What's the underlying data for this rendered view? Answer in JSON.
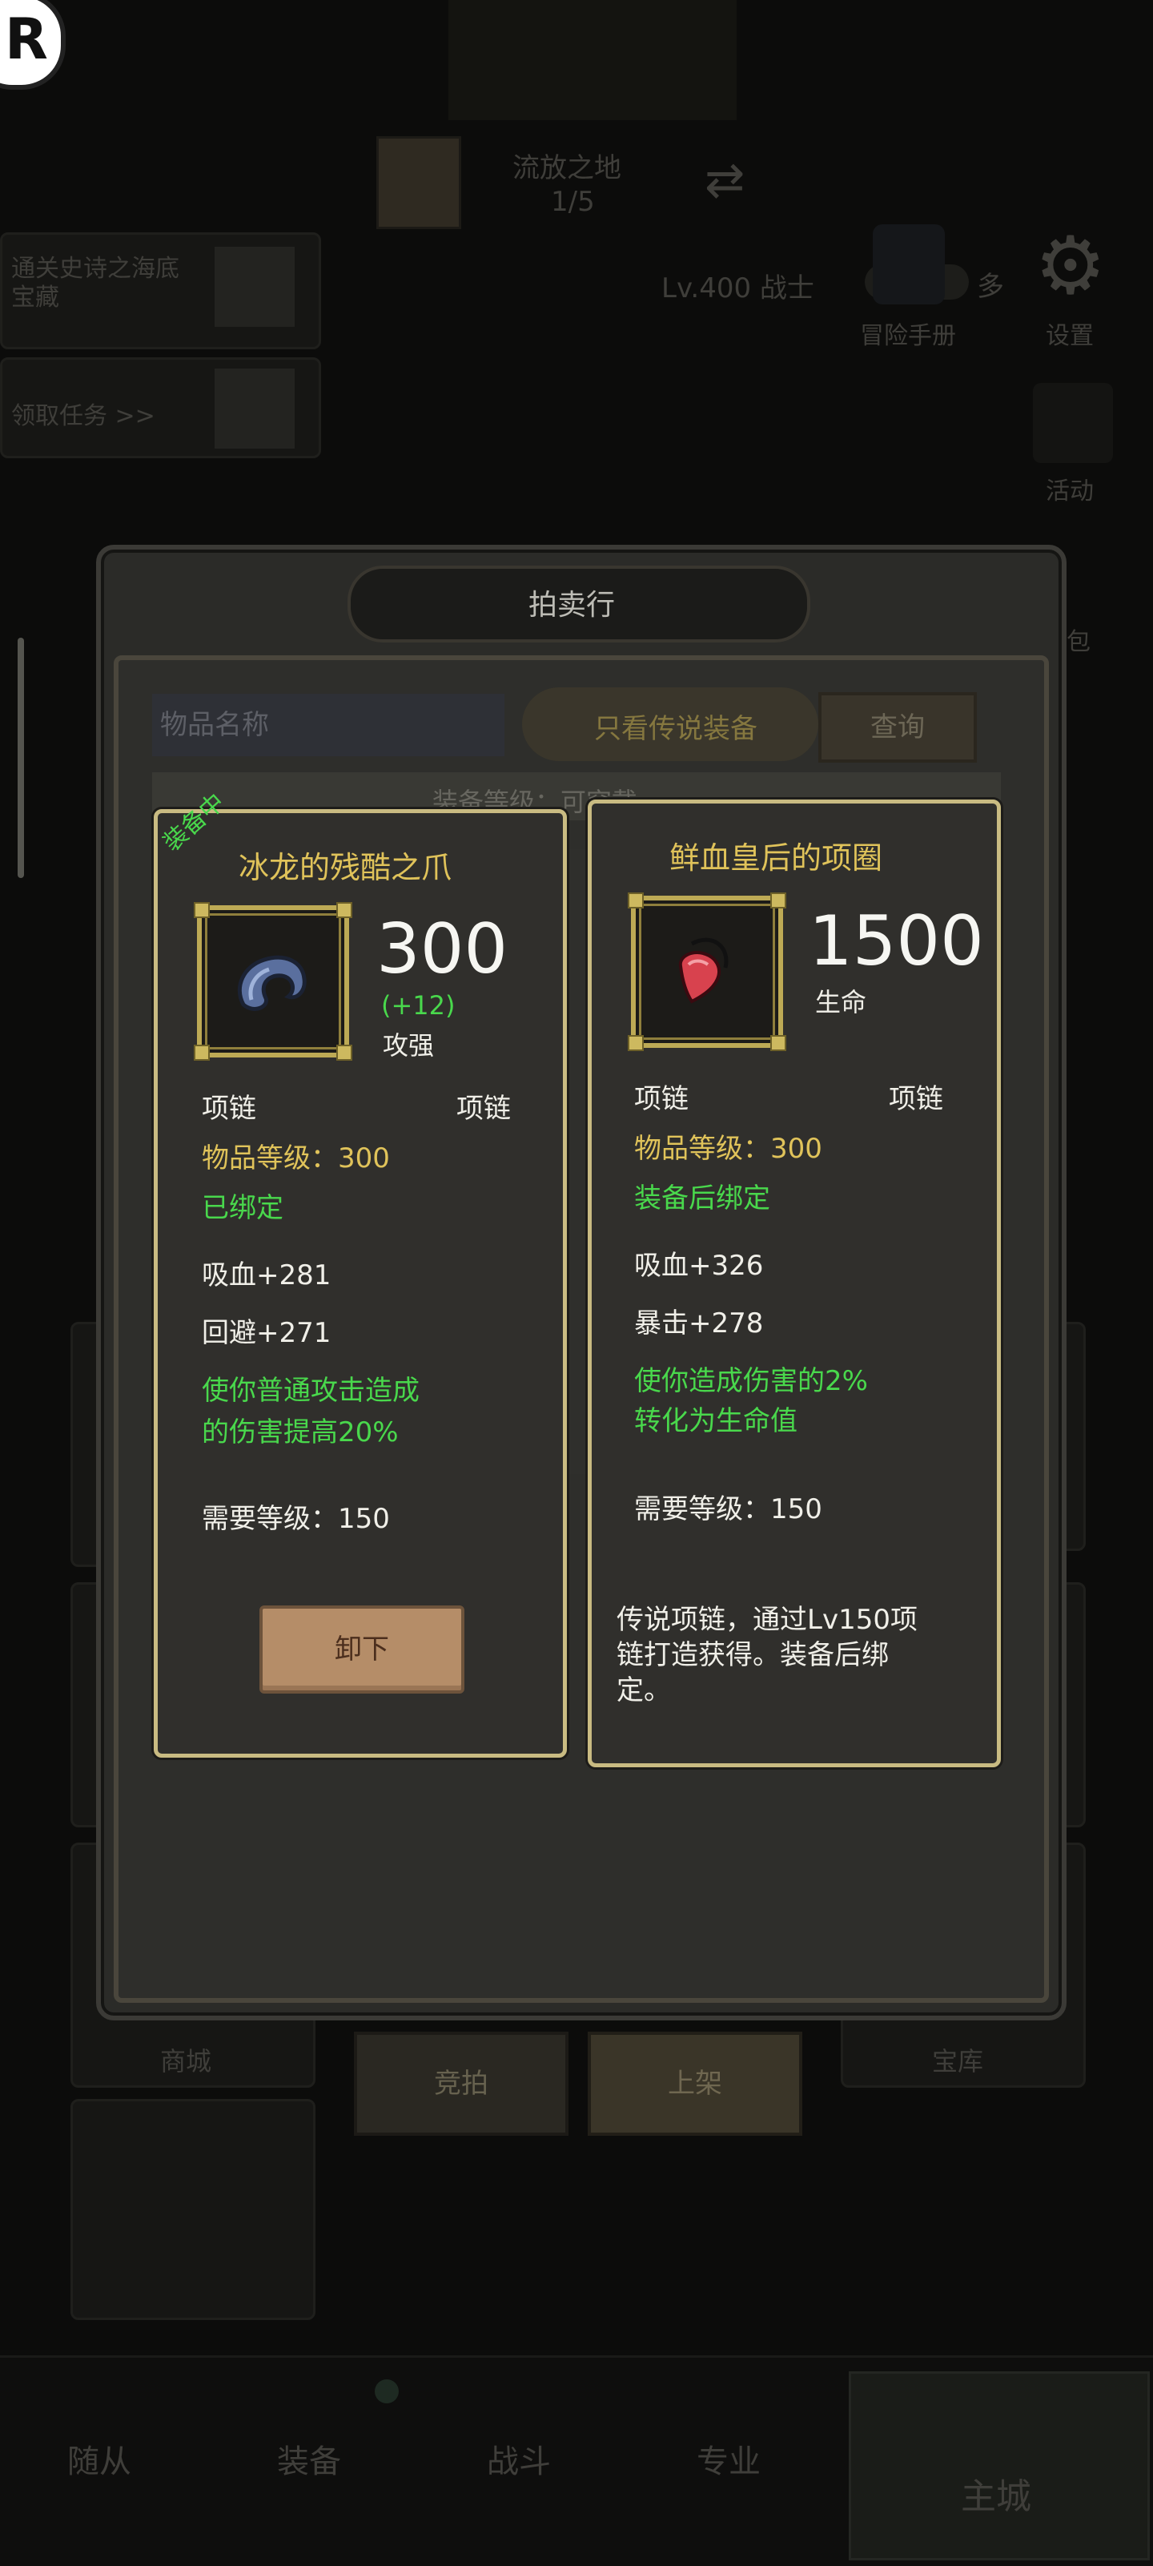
{
  "background": {
    "map_name": "流放之地",
    "map_progress": "1/5",
    "quest1": "通关史诗之海底宝藏",
    "quest2": "领取任务 >>",
    "player": "Lv.400 战士",
    "multi_label": "多",
    "adventure_manual": "冒险手册",
    "settings": "设置",
    "activity": "活动",
    "gift_bag": "包",
    "shop": "商城",
    "treasury": "宝库",
    "bottom_tabs": [
      "随从",
      "装备",
      "战斗",
      "专业",
      "主城"
    ]
  },
  "auction": {
    "title": "拍卖行",
    "search_placeholder": "物品名称",
    "legend_only": "只看传说装备",
    "query_button": "查询",
    "filter_label": "装备等级：可穿戴",
    "bid_button": "竞拍",
    "list_button": "上架"
  },
  "left_card": {
    "equipped_badge": "装备中",
    "name": "冰龙的残酷之爪",
    "value": "300",
    "bonus": "(+12)",
    "stat_label": "攻强",
    "slot_left": "项链",
    "slot_right": "项链",
    "item_level": "物品等级：300",
    "bind": "已绑定",
    "stats": [
      "吸血+281",
      "回避+271"
    ],
    "effect_line1": "使你普通攻击造成",
    "effect_line2": "的伤害提高20%",
    "required_level": "需要等级：150",
    "unequip_button": "卸下"
  },
  "right_card": {
    "name": "鲜血皇后的项圈",
    "value": "1500",
    "stat_label": "生命",
    "slot_left": "项链",
    "slot_right": "项链",
    "item_level": "物品等级：300",
    "bind": "装备后绑定",
    "stats": [
      "吸血+326",
      "暴击+278"
    ],
    "effect_line1": "使你造成伤害的2%",
    "effect_line2": "转化为生命值",
    "required_level": "需要等级：150",
    "desc_line1": "传说项链，通过Lv150项",
    "desc_line2": "链打造获得。装备后绑",
    "desc_line3": "定。"
  },
  "colors": {
    "card_border": "#c9bb82",
    "gold_text": "#e0c35a",
    "green_text": "#49d84c"
  }
}
